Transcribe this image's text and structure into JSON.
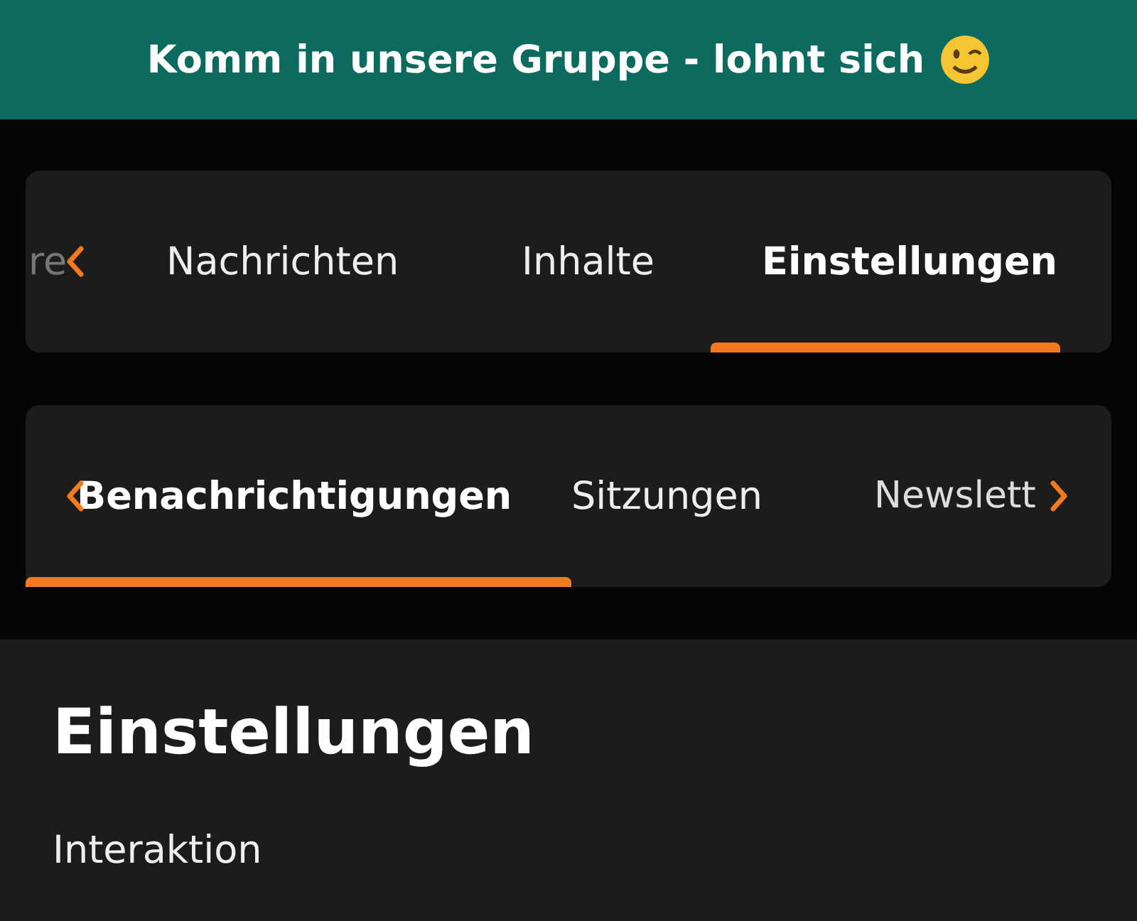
{
  "banner": {
    "text": "Komm in unsere Gruppe - lohnt sich"
  },
  "tab_bars": [
    {
      "tabs": [
        {
          "label": "re",
          "selected": false,
          "kind": "partial"
        },
        {
          "label": "Nachrichten",
          "selected": false,
          "kind": "tab"
        },
        {
          "label": "Inhalte",
          "selected": false,
          "kind": "tab"
        },
        {
          "label": "Einstellungen",
          "selected": true,
          "kind": "tab"
        }
      ]
    },
    {
      "tabs": [
        {
          "label": "Benachrichtigungen",
          "selected": true,
          "kind": "tab"
        },
        {
          "label": "Sitzungen",
          "selected": false,
          "kind": "tab"
        },
        {
          "label": "Newslett",
          "selected": false,
          "kind": "partial"
        }
      ]
    }
  ],
  "content": {
    "heading": "Einstellungen",
    "section": "Interaktion"
  }
}
